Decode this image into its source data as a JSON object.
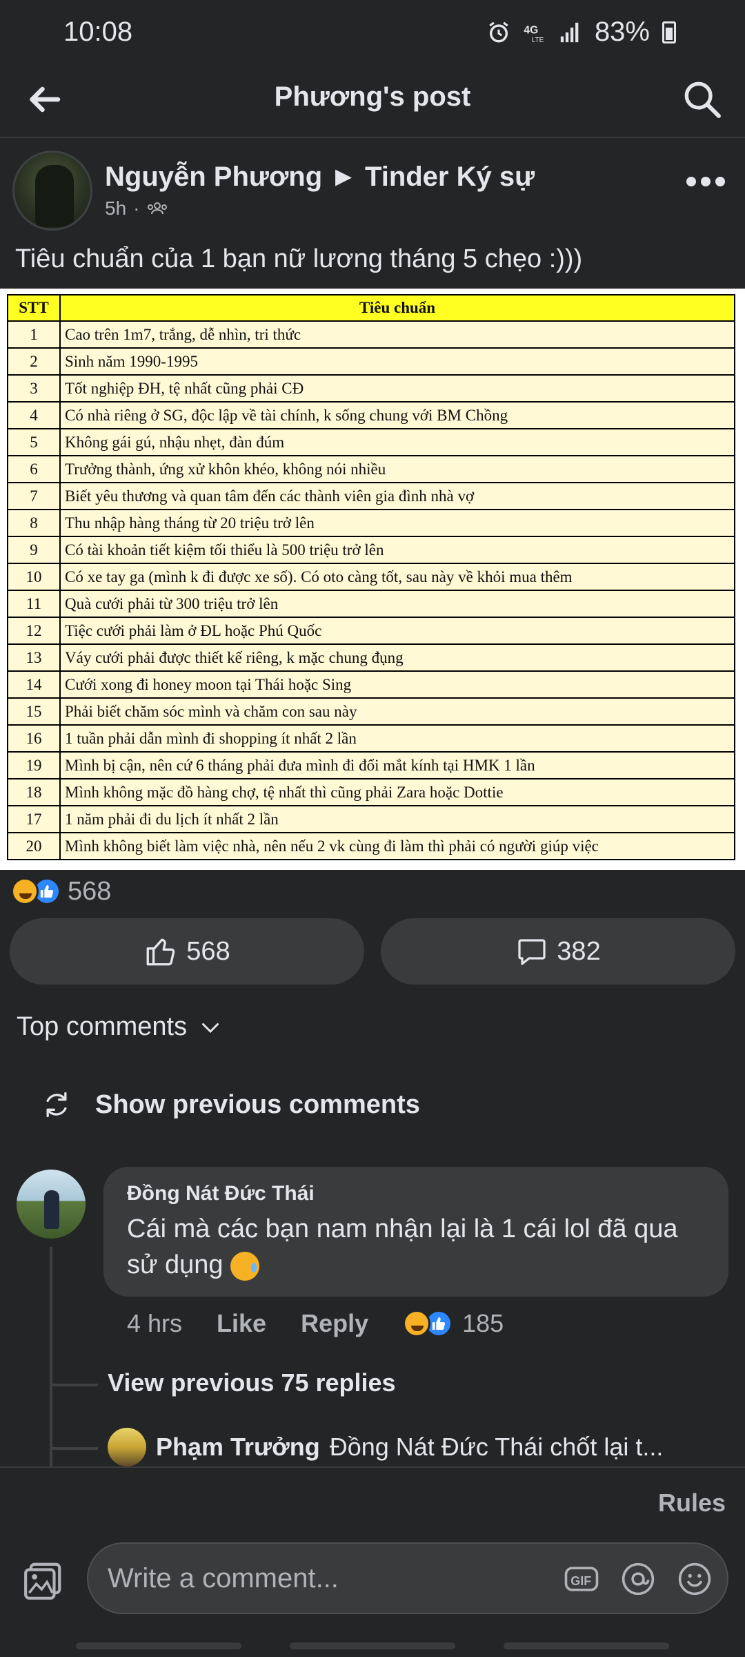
{
  "status_bar": {
    "time": "10:08",
    "network": "4G LTE",
    "battery": "83%"
  },
  "header": {
    "title": "Phương's post"
  },
  "post": {
    "author": "Nguyễn Phương ► Tinder Ký sự",
    "time": "5h",
    "separator": "·",
    "caption": "Tiêu chuẩn của 1 bạn nữ lương tháng 5 chẹo :)))",
    "table": {
      "headers": [
        "STT",
        "Tiêu chuẩn"
      ],
      "rows": [
        [
          "1",
          "Cao trên 1m7, trắng, dễ nhìn, tri thức"
        ],
        [
          "2",
          "Sinh năm 1990-1995"
        ],
        [
          "3",
          "Tốt nghiệp ĐH, tệ nhất cũng phải CĐ"
        ],
        [
          "4",
          "Có nhà riêng ở SG, độc lập về tài chính, k sống chung với BM Chồng"
        ],
        [
          "5",
          "Không gái gú, nhậu nhẹt, đàn đúm"
        ],
        [
          "6",
          "Trưởng thành, ứng xử khôn khéo, không nói nhiều"
        ],
        [
          "7",
          "Biết yêu thương và quan tâm đến các thành viên gia đình nhà vợ"
        ],
        [
          "8",
          "Thu nhập hàng tháng từ 20 triệu trở lên"
        ],
        [
          "9",
          "Có tài khoản tiết kiệm tối thiểu là 500 triệu trở lên"
        ],
        [
          "10",
          "Có xe tay ga (mình k đi được xe số). Có oto càng tốt, sau này về khỏi mua thêm"
        ],
        [
          "11",
          "Quà cưới phải từ 300 triệu trở lên"
        ],
        [
          "12",
          "Tiệc cưới phải làm ở ĐL hoặc Phú Quốc"
        ],
        [
          "13",
          "Váy cưới phải được thiết kế riêng, k mặc chung đụng"
        ],
        [
          "14",
          "Cưới xong đi honey moon tại Thái hoặc Sing"
        ],
        [
          "15",
          "Phải biết chăm sóc mình và chăm con sau này"
        ],
        [
          "16",
          "1 tuần phải dẫn mình đi shopping ít nhất 2 lần"
        ],
        [
          "19",
          "Mình bị cận, nên cứ 6 tháng phải đưa mình đi đổi mắt kính tại HMK 1 lần"
        ],
        [
          "18",
          "Mình không mặc đồ hàng chợ, tệ nhất thì cũng phải Zara hoặc Dottie"
        ],
        [
          "17",
          "1 năm phải đi du lịch ít nhất 2 lần"
        ],
        [
          "20",
          "Mình không biết làm việc nhà, nên nếu 2 vk cùng đi làm thì phải có người giúp việc"
        ]
      ]
    },
    "reactions_count": "568",
    "like_button_count": "568",
    "comment_button_count": "382"
  },
  "comments": {
    "filter_label": "Top comments",
    "show_previous": "Show previous comments",
    "items": [
      {
        "name": "Đồng Nát Đức Thái",
        "text": "Cái mà các bạn nam nhận lại là 1 cái lol đã qua sử dụng",
        "time": "4 hrs",
        "like": "Like",
        "reply": "Reply",
        "reactions": "185"
      }
    ],
    "view_previous_replies": "View previous 75 replies",
    "reply_preview": {
      "name": "Phạm Trưởng",
      "text": "Đồng Nát Đức Thái chốt lại t..."
    }
  },
  "composer": {
    "rules": "Rules",
    "placeholder": "Write a comment...",
    "gif_label": "GIF"
  },
  "colors": {
    "background": "#242526",
    "surface": "#3a3b3c",
    "text": "#e4e6eb",
    "secondary": "#b0b3b8",
    "like_blue": "#2d88ff",
    "table_header": "#ffff22"
  }
}
